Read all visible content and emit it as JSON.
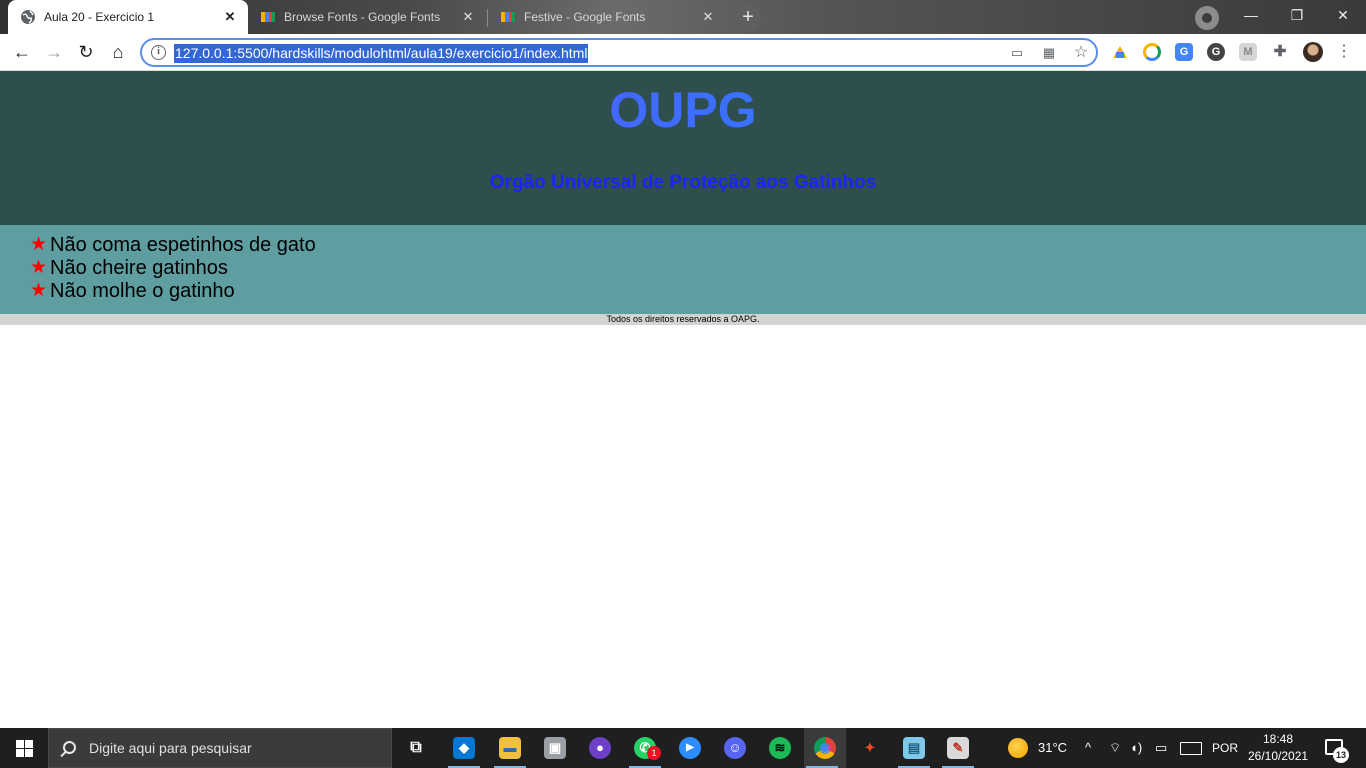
{
  "browser": {
    "tabs": [
      {
        "title": "Aula 20 - Exercicio 1",
        "favicon": "globe-icon",
        "active": true
      },
      {
        "title": "Browse Fonts - Google Fonts",
        "favicon": "google-fonts-icon",
        "active": false
      },
      {
        "title": "Festive - Google Fonts",
        "favicon": "google-fonts-icon",
        "active": false
      }
    ],
    "new_tab_label": "+",
    "window_controls": {
      "minimize": "—",
      "maximize": "❐",
      "close": "✕"
    },
    "url": "127.0.0.1:5500/hardskills/modulohtml/aula19/exercicio1/index.html",
    "nav": {
      "back": "←",
      "forward": "→",
      "reload": "↻",
      "home": "⌂"
    }
  },
  "page": {
    "title": "OUPG",
    "subtitle": "Orgão Universal de Proteção aos Gatinhos",
    "rules": [
      "Não coma espetinhos de gato",
      "Não cheire gatinhos",
      "Não molhe o gatinho"
    ],
    "footer": "Todos os direitos reservados a OAPG.",
    "colors": {
      "header_bg": "#2f4f4f",
      "rules_bg": "#5f9ea0",
      "footer_bg": "#d3d3d3",
      "subtitle": "#1b24ff",
      "star": "#ff0000"
    }
  },
  "taskbar": {
    "search_placeholder": "Digite aqui para pesquisar",
    "apps": [
      {
        "name": "task-view-icon",
        "glyph": "⧉"
      },
      {
        "name": "vscode-icon",
        "glyph": "◆"
      },
      {
        "name": "file-explorer-icon",
        "glyph": "▬"
      },
      {
        "name": "photos-app-icon",
        "glyph": "▣"
      },
      {
        "name": "github-desktop-icon",
        "glyph": "●"
      },
      {
        "name": "whatsapp-icon",
        "glyph": "✆",
        "badge": "1"
      },
      {
        "name": "zoom-icon",
        "glyph": "▶"
      },
      {
        "name": "discord-icon",
        "glyph": "☺"
      },
      {
        "name": "spotify-icon",
        "glyph": "≋"
      },
      {
        "name": "chrome-icon",
        "glyph": "◉"
      },
      {
        "name": "figma-icon",
        "glyph": "✦"
      },
      {
        "name": "notes-app-icon",
        "glyph": "▤"
      },
      {
        "name": "paint-app-icon",
        "glyph": "✎"
      }
    ],
    "weather": "31°C",
    "language": "POR",
    "time": "18:48",
    "date": "26/10/2021",
    "notification_count": "13"
  }
}
